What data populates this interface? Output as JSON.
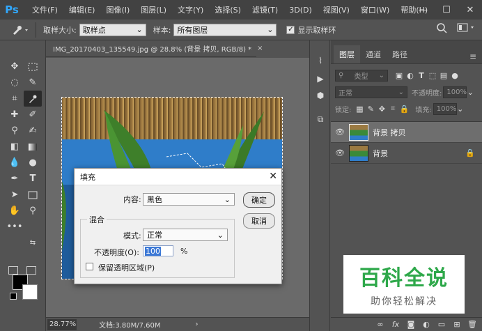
{
  "app": {
    "logo": "Ps"
  },
  "menu": [
    "文件(F)",
    "编辑(E)",
    "图像(I)",
    "图层(L)",
    "文字(Y)",
    "选择(S)",
    "滤镜(T)",
    "3D(D)",
    "视图(V)",
    "窗口(W)",
    "帮助(H)"
  ],
  "window_controls": {
    "minimize": "—",
    "maximize": "☐",
    "close": "✕"
  },
  "options_bar": {
    "sample_size_label": "取样大小:",
    "sample_size_value": "取样点",
    "sample_label": "样本:",
    "sample_value": "所有图层",
    "show_ring_label": "显示取样环",
    "show_ring_checked": true
  },
  "document": {
    "tab_title": "IMG_20170403_135549.jpg @ 28.8% (背景 拷贝, RGB/8) *",
    "tab_close": "×",
    "zoom": "28.77%",
    "doc_size": "文档:3.80M/7.60M"
  },
  "layers_panel": {
    "tabs": [
      "图层",
      "通道",
      "路径"
    ],
    "active_tab": "图层",
    "filter_label": "类型",
    "blend_mode": "正常",
    "opacity_label": "不透明度:",
    "opacity_value": "100%",
    "lock_label": "锁定:",
    "fill_label": "填充:",
    "fill_value": "100%",
    "layers": [
      {
        "name": "背景 拷贝",
        "selected": true,
        "locked": false
      },
      {
        "name": "背景",
        "selected": false,
        "locked": true
      }
    ],
    "bottom_fx": "fx"
  },
  "fill_dialog": {
    "title": "填充",
    "content_label": "内容:",
    "content_value": "黑色",
    "ok_label": "确定",
    "cancel_label": "取消",
    "blend_group_label": "混合",
    "mode_label": "模式:",
    "mode_value": "正常",
    "opacity_label": "不透明度(O):",
    "opacity_value": "100",
    "opacity_unit": "%",
    "preserve_label": "保留透明区域(P)",
    "preserve_checked": false
  },
  "watermark": {
    "title": "百科全说",
    "subtitle": "助你轻松解决"
  },
  "colors": {
    "fg": "#000000",
    "bg": "#ffffff",
    "accent": "#31a8ff",
    "watermark_green": "#2ea84a"
  }
}
